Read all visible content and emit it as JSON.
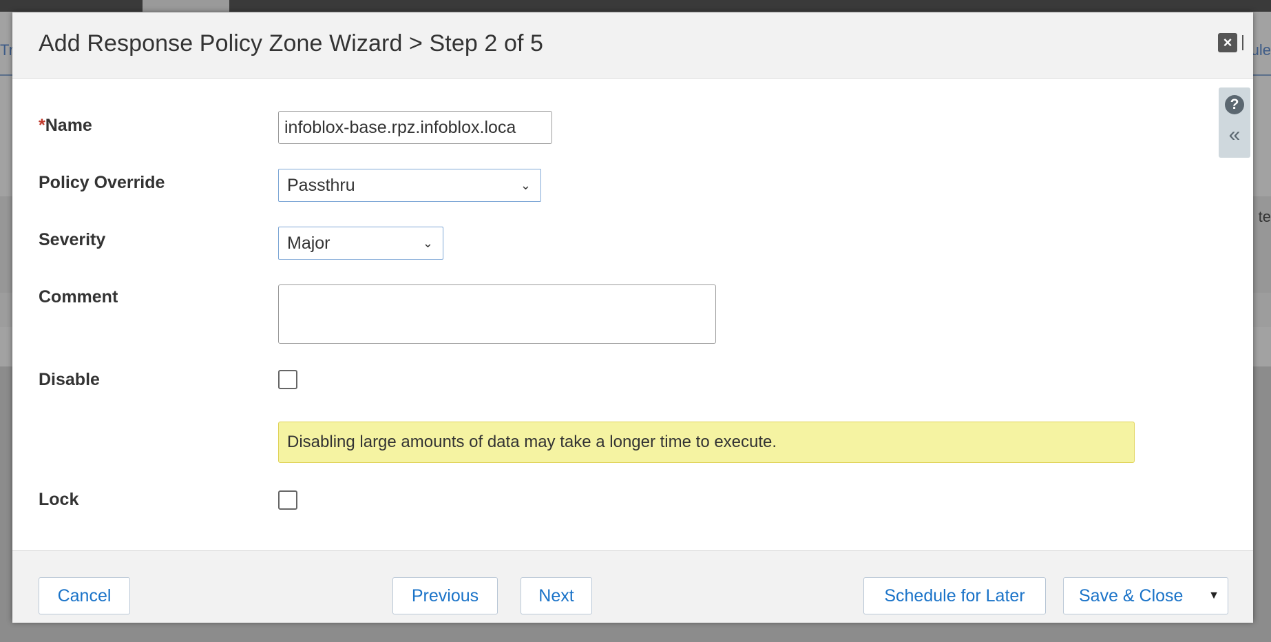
{
  "background": {
    "left_text": "Tr",
    "right_text": "ule",
    "right_text_2": "te"
  },
  "modal": {
    "title": "Add Response Policy Zone Wizard > Step 2 of 5",
    "close_icon": "×"
  },
  "help": {
    "help_icon": "?",
    "collapse_icon": "«"
  },
  "form": {
    "name": {
      "required_marker": "*",
      "label": "Name",
      "value": "infoblox-base.rpz.infoblox.loca"
    },
    "policy_override": {
      "label": "Policy Override",
      "value": "Passthru"
    },
    "severity": {
      "label": "Severity",
      "value": "Major"
    },
    "comment": {
      "label": "Comment",
      "value": ""
    },
    "disable": {
      "label": "Disable",
      "checked": false
    },
    "warning": "Disabling large amounts of data may take a longer time to execute.",
    "lock": {
      "label": "Lock",
      "checked": false
    }
  },
  "footer": {
    "cancel_label": "Cancel",
    "previous_label": "Previous",
    "next_label": "Next",
    "schedule_label": "Schedule for Later",
    "save_close_label": "Save & Close"
  },
  "colors": {
    "link_blue": "#1a73c8",
    "warning_bg": "#f5f3a2",
    "required_red": "#c0392b"
  }
}
